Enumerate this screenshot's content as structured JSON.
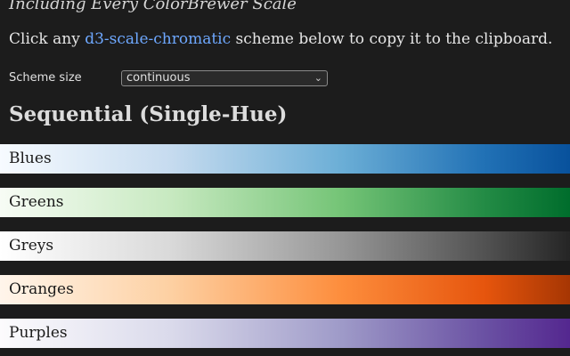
{
  "header": {
    "subtitle": "Including Every ColorBrewer Scale",
    "intro_before": "Click any ",
    "intro_link": "d3-scale-chromatic",
    "intro_after": " scheme below to copy it to the clipboard."
  },
  "controls": {
    "scheme_size_label": "Scheme size",
    "scheme_size_value": "continuous"
  },
  "section": {
    "title": "Sequential (Single-Hue)"
  },
  "schemes": [
    {
      "name": "Blues",
      "colors": [
        "#f7fbff",
        "#c6dbef",
        "#6baed6",
        "#2171b5",
        "#08519c"
      ]
    },
    {
      "name": "Greens",
      "colors": [
        "#f7fcf5",
        "#c7e9c0",
        "#74c476",
        "#238b45",
        "#006d2c"
      ]
    },
    {
      "name": "Greys",
      "colors": [
        "#ffffff",
        "#d9d9d9",
        "#969696",
        "#525252",
        "#252525"
      ]
    },
    {
      "name": "Oranges",
      "colors": [
        "#fff5eb",
        "#fdd0a2",
        "#fd8d3c",
        "#e6550d",
        "#a63603"
      ]
    },
    {
      "name": "Purples",
      "colors": [
        "#fcfbfd",
        "#dadaeb",
        "#9e9ac8",
        "#6a51a3",
        "#54278f"
      ]
    }
  ],
  "theme": {
    "background": "#1c1c1c",
    "link": "#6ea8ff"
  }
}
